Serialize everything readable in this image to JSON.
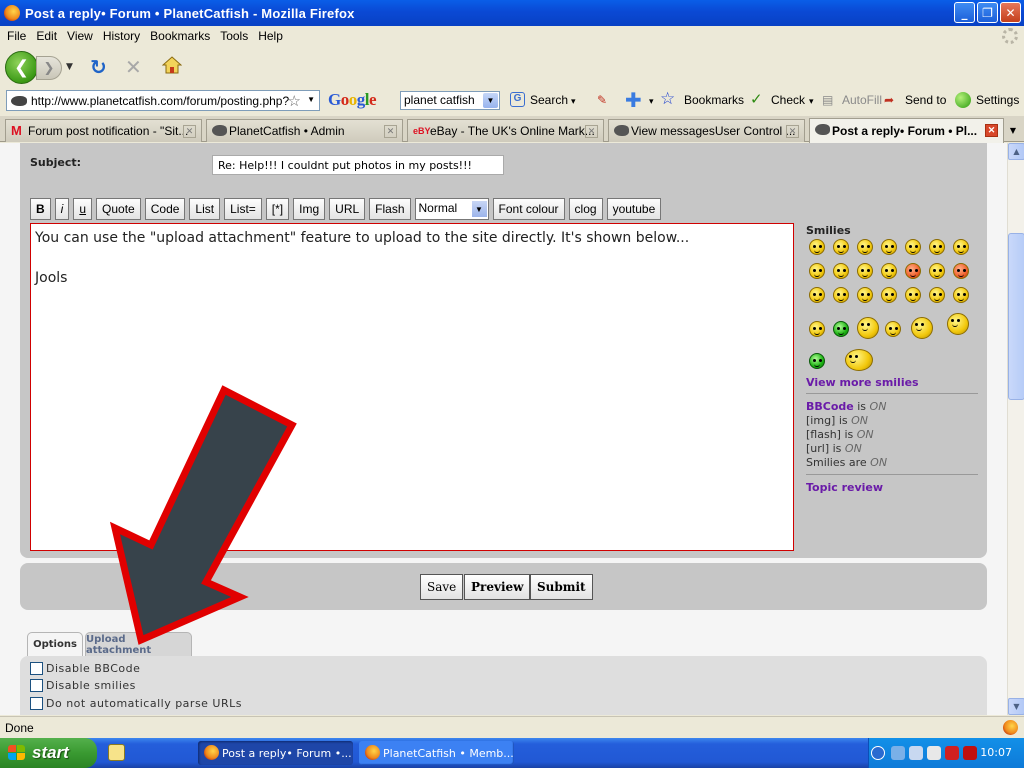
{
  "window": {
    "title": "Post a reply• Forum • PlanetCatfish - Mozilla Firefox"
  },
  "menu": [
    "File",
    "Edit",
    "View",
    "History",
    "Bookmarks",
    "Tools",
    "Help"
  ],
  "address": {
    "url": "http://www.planetcatfish.com/forum/posting.php?"
  },
  "google_toolbar": {
    "brand": "Google",
    "query": "planet catfish",
    "search_label": "Search",
    "bookmarks_label": "Bookmarks",
    "check_label": "Check",
    "autofill_label": "AutoFill",
    "sendto_label": "Send to",
    "settings_label": "Settings"
  },
  "tabs": [
    {
      "label": "Forum post notification - \"Sit...",
      "icon": "gmail-icon"
    },
    {
      "label": "PlanetCatfish • Admin",
      "icon": "catfish-icon"
    },
    {
      "label": "eBay - The UK's Online Mark...",
      "icon": "ebay-icon"
    },
    {
      "label": "View messagesUser Control ...",
      "icon": "catfish-icon"
    },
    {
      "label": "Post a reply• Forum • Pl...",
      "icon": "catfish-icon",
      "active": true
    }
  ],
  "form": {
    "subject_label": "Subject:",
    "subject_value": "Re: Help!!! I couldnt put photos in my posts!!!",
    "format_buttons": [
      "B",
      "i",
      "u",
      "Quote",
      "Code",
      "List",
      "List=",
      "[*]",
      "Img",
      "URL",
      "Flash"
    ],
    "font_size": "Normal",
    "format_buttons_2": [
      "Font colour",
      "clog",
      "youtube"
    ],
    "message": "You can use the \"upload attachment\" feature to upload to the site directly. It's shown below...\n\nJools"
  },
  "sidebar": {
    "smilies_heading": "Smilies",
    "view_more": "View more smilies",
    "bbcode_link": "BBCode",
    "bbcode_is": "is",
    "on": "ON",
    "img_status": "[img] is",
    "flash_status": "[flash] is",
    "url_status": "[url] is",
    "smilies_status": "Smilies are",
    "topic_review": "Topic review"
  },
  "actions": {
    "save": "Save",
    "preview": "Preview",
    "submit": "Submit"
  },
  "option_tabs": {
    "options": "Options",
    "upload": "Upload attachment"
  },
  "options": [
    "Disable BBCode",
    "Disable smilies",
    "Do not automatically parse URLs"
  ],
  "status": {
    "text": "Done"
  },
  "taskbar": {
    "start": "start",
    "tasks": [
      "Post a reply• Forum •...",
      "PlanetCatfish • Memb..."
    ],
    "clock": "10:07"
  },
  "colors": {
    "accent_red": "#d00000",
    "arrow_fill": "#37434b",
    "link_purple": "#6a1ba8"
  }
}
